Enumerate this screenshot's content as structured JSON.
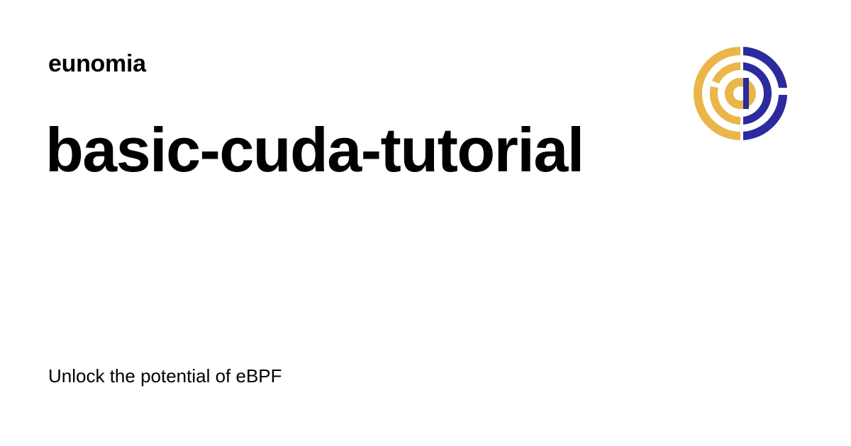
{
  "site": {
    "name": "eunomia"
  },
  "page": {
    "title": "basic-cuda-tutorial",
    "tagline": "Unlock the potential of eBPF"
  },
  "logo": {
    "icon": "eunomia-logo-icon",
    "colors": {
      "gold": "#EAB64A",
      "navy": "#2B2A9E"
    }
  }
}
